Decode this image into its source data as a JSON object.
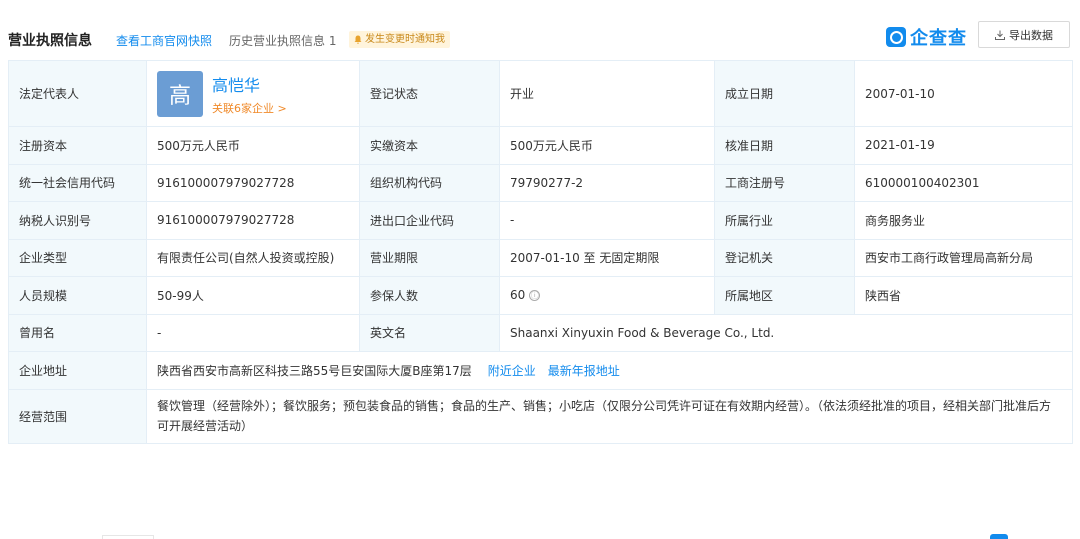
{
  "header": {
    "title": "营业执照信息",
    "link_gov": "查看工商官网快照",
    "link_history": "历史营业执照信息 1",
    "notify": "发生变更时通知我",
    "brand": "企查查",
    "export": "导出数据"
  },
  "rows": [
    {
      "label": "法定代表人",
      "person": {
        "avatar": "高",
        "name": "高恺华",
        "related": "关联6家企业 >"
      },
      "l2": "登记状态",
      "v2": "开业",
      "l3": "成立日期",
      "v3": "2007-01-10"
    },
    {
      "label": "注册资本",
      "v1": "500万元人民币",
      "l2": "实缴资本",
      "v2": "500万元人民币",
      "l3": "核准日期",
      "v3": "2021-01-19"
    },
    {
      "label": "统一社会信用代码",
      "v1": "916100007979027728",
      "l2": "组织机构代码",
      "v2": "79790277-2",
      "l3": "工商注册号",
      "v3": "610000100402301"
    },
    {
      "label": "纳税人识别号",
      "v1": "916100007979027728",
      "l2": "进出口企业代码",
      "v2": "-",
      "l3": "所属行业",
      "v3": "商务服务业"
    },
    {
      "label": "企业类型",
      "v1": "有限责任公司(自然人投资或控股)",
      "l2": "营业期限",
      "v2": "2007-01-10 至 无固定期限",
      "l3": "登记机关",
      "v3": "西安市工商行政管理局高新分局"
    },
    {
      "label": "人员规模",
      "v1": "50-99人",
      "l2": "参保人数",
      "v2": "60",
      "info_icon": "ⓘ",
      "l3": "所属地区",
      "v3": "陕西省"
    },
    {
      "label": "曾用名",
      "v1": "-",
      "l2": "英文名",
      "v2": "Shaanxi Xinyuxin Food & Beverage Co., Ltd."
    },
    {
      "label": "企业地址",
      "v1": "陕西省西安市高新区科技三路55号巨安国际大厦B座第17层",
      "link_nearby": "附近企业",
      "link_annual": "最新年报地址"
    },
    {
      "label": "经营范围",
      "v1": "餐饮管理（经营除外）；餐饮服务；预包装食品的销售；食品的生产、销售；小吃店（仅限分公司凭许可证在有效期内经营）。（依法须经批准的项目，经相关部门批准后方可开展经营活动）"
    }
  ]
}
